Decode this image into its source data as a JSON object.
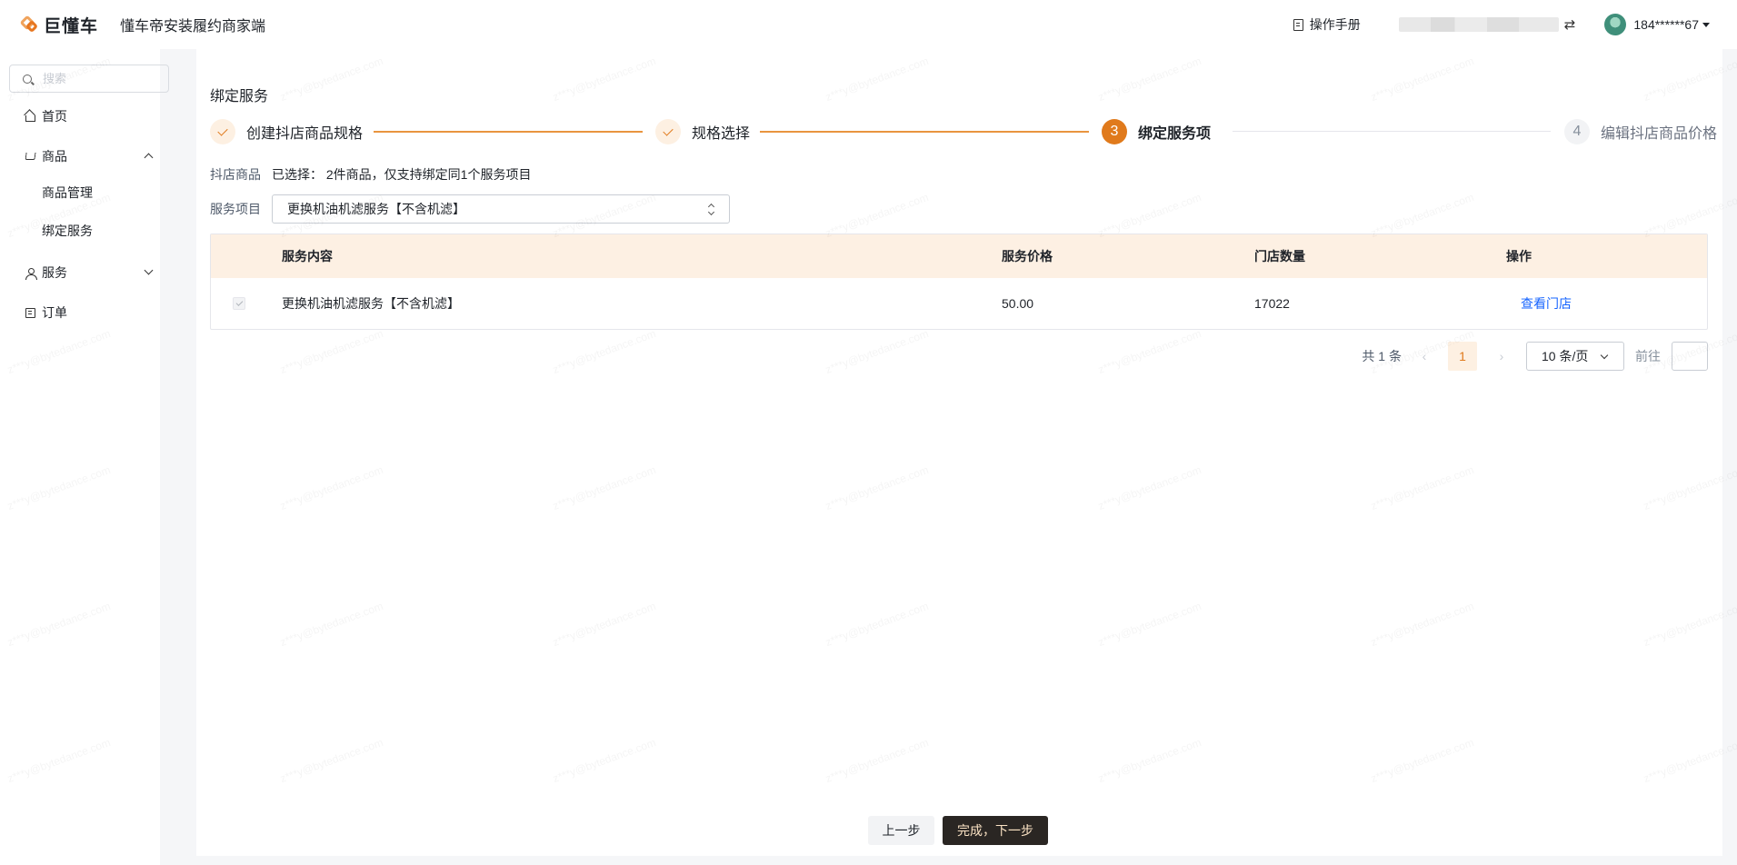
{
  "header": {
    "logo_text": "巨懂车",
    "app_title": "懂车帝安装履约商家端",
    "manual_label": "操作手册",
    "swap_symbol": "⇄",
    "account": "184******67"
  },
  "sidebar": {
    "search_placeholder": "搜索",
    "items": [
      {
        "label": "首页",
        "icon": "home-icon"
      },
      {
        "label": "商品",
        "icon": "cart-icon",
        "expanded": true,
        "children": [
          "商品管理",
          "绑定服务"
        ]
      },
      {
        "label": "服务",
        "icon": "user-icon",
        "expanded": false
      },
      {
        "label": "订单",
        "icon": "order-icon"
      }
    ]
  },
  "main": {
    "title": "绑定服务",
    "steps": [
      {
        "label": "创建抖店商品规格",
        "status": "done"
      },
      {
        "label": "规格选择",
        "status": "done"
      },
      {
        "number": "3",
        "label": "绑定服务项",
        "status": "active"
      },
      {
        "number": "4",
        "label": "编辑抖店商品价格",
        "status": "todo"
      }
    ],
    "product_label": "抖店商品",
    "product_value": "已选择： 2件商品，仅支持绑定同1个服务项目",
    "service_label": "服务项目",
    "service_value": "更换机油机滤服务【不含机滤】",
    "table": {
      "columns": [
        "服务内容",
        "服务价格",
        "门店数量",
        "操作"
      ],
      "rows": [
        {
          "content": "更换机油机滤服务【不含机滤】",
          "price": "50.00",
          "stores": "17022",
          "action": "查看门店",
          "checked": true
        }
      ]
    },
    "pagination": {
      "total": "共 1 条",
      "prev": "‹",
      "current": "1",
      "next": "›",
      "page_size": "10 条/页",
      "goto": "前往"
    }
  },
  "footer": {
    "prev_label": "上一步",
    "next_label": "完成，下一步"
  },
  "watermark": "z***y@bytedance.com",
  "colors": {
    "accent": "#e07a1c",
    "table_header_bg": "#fdf0e3",
    "link": "#1664ff",
    "primary_button": "#2a2623"
  }
}
